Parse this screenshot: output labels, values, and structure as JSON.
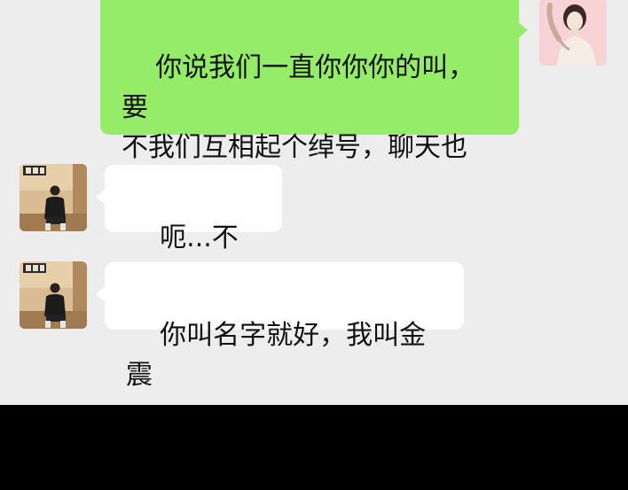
{
  "messages": [
    {
      "sender": "self",
      "avatar_icon": "woman-portrait-avatar-icon",
      "text": "你说我们一直你你你的叫，要\n不我们互相起个绰号，聊天也\n方便点"
    },
    {
      "sender": "contact",
      "avatar_icon": "man-sitting-avatar-icon",
      "text": "呃...不用吧"
    },
    {
      "sender": "contact",
      "avatar_icon": "man-sitting-avatar-icon",
      "text": "你叫名字就好，我叫金震"
    }
  ],
  "colors": {
    "chat_background": "#ededed",
    "self_bubble": "#95ec69",
    "contact_bubble": "#ffffff",
    "footer": "#000000"
  }
}
